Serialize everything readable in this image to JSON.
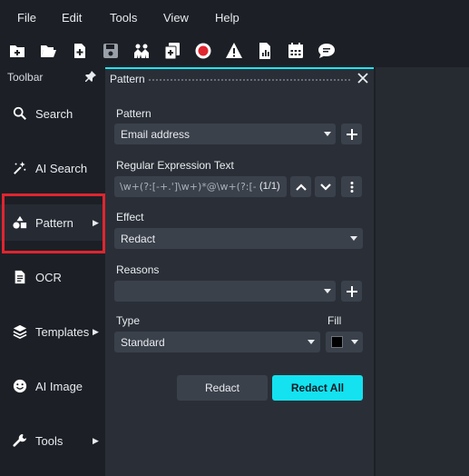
{
  "menu": [
    "File",
    "Edit",
    "Tools",
    "View",
    "Help"
  ],
  "icons": {
    "new": "new-file-icon",
    "open": "folder-open-icon",
    "add": "add-file-icon",
    "save": "save-icon",
    "users": "people-icon",
    "copy": "copy-add-icon",
    "record": "record-icon",
    "warning": "warning-icon",
    "report": "report-icon",
    "calendar": "calendar-icon",
    "chat": "chat-icon"
  },
  "colors": {
    "accent": "#14e2f0",
    "record": "#e0252f",
    "highlight": "#e0252f"
  },
  "toolbar": {
    "title": "Toolbar",
    "tools": [
      {
        "label": "Search",
        "icon": "search-icon"
      },
      {
        "label": "AI Search",
        "icon": "magic-wand-icon"
      },
      {
        "label": "Pattern",
        "icon": "shapes-icon"
      },
      {
        "label": "OCR",
        "icon": "document-icon"
      },
      {
        "label": "Templates",
        "icon": "layers-icon"
      },
      {
        "label": "AI Image",
        "icon": "smile-icon"
      },
      {
        "label": "Tools",
        "icon": "wrench-icon"
      }
    ]
  },
  "dialog": {
    "title": "Pattern",
    "pattern_label": "Pattern",
    "pattern_value": "Email address",
    "regex_label": "Regular Expression Text",
    "regex_value": "\\w+(?:[-+.']\\w+)*@\\w+(?:[-.]\\w+)*\\.\\w+(?:[-.]\\w+)*",
    "regex_count": "(1/1)",
    "effect_label": "Effect",
    "effect_value": "Redact",
    "reasons_label": "Reasons",
    "reasons_value": "",
    "type_label": "Type",
    "type_value": "Standard",
    "fill_label": "Fill",
    "fill_color": "#000000",
    "redact_button": "Redact",
    "redact_all_button": "Redact All"
  }
}
